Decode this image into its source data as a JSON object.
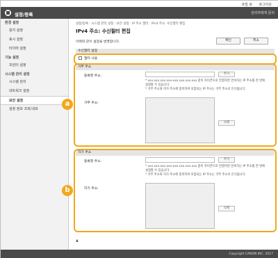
{
  "topbar": {
    "link1": "포털 로 ",
    "link2": "로그아웃"
  },
  "titlebar": {
    "title": "설정/등록",
    "admin": "관리자에게 문의"
  },
  "sidebar": {
    "sections": [
      {
        "head": "환경 설정",
        "items": [
          "용지 설정",
          "표시 설정",
          "타이머 설정"
        ]
      },
      {
        "head": "기능 설정",
        "items": [
          "프린터 설정"
        ]
      },
      {
        "head": "시스템 관리 설정",
        "items": [
          "시스템 관리",
          "네트워크 설정",
          "보안 설정",
          "설정 정보 조회/내보"
        ]
      }
    ]
  },
  "breadcrumb": "설정/등록 : 시스템 관리 설정 : 보안 설정 : IP 주소 필터 : IPv4 주소: 수신필터 편집",
  "page_title": "IPv4 주소: 수신필터 편집",
  "notice": "아래와 같이 설정을 변경합니다.",
  "buttons": {
    "ok": "확인",
    "cancel": "취소"
  },
  "filter_section": {
    "title": "수신필터 설정",
    "checkbox_label": "필터 사용"
  },
  "reject": {
    "title": "거부 주소",
    "add_label": "등록할 주소:",
    "add_button": "추가",
    "note1": "* xxx.xxx.xxx.xxx-xxx.xxx.xxx.xxx 같이 하이픈으로 연결하면 연속하는 IP 주소를 한 번에 설정할 수 있습니다.",
    "note2": "* 거부 주소와 허가 주소에 중복하여 포함되는 IP 주소는 거부 주소로 인식됩니다.",
    "list_label": "거부 주소:",
    "delete_button": "삭제"
  },
  "allow": {
    "title": "허가 주소",
    "add_label": "등록할 주소:",
    "add_button": "추가",
    "note1": "* xxx.xxx.xxx.xxx-xxx.xxx.xxx.xxx 같이 하이픈으로 연결하면 연속하는 IP 주소를 한 번에 설정할 수 있습니다.",
    "note2": "* 거부 주소와 허가 주소에 중복하여 포함되는 IP 주소는 거부 주소로 인식됩니다.",
    "list_label": "허가 주소:",
    "delete_button": "삭제"
  },
  "markers": {
    "a": "a",
    "b": "b"
  },
  "top_link": "▲",
  "footer": "Copyright CANON INC. 2017",
  "colors": {
    "accent": "#f0a81c",
    "header": "#4a4a4a"
  }
}
